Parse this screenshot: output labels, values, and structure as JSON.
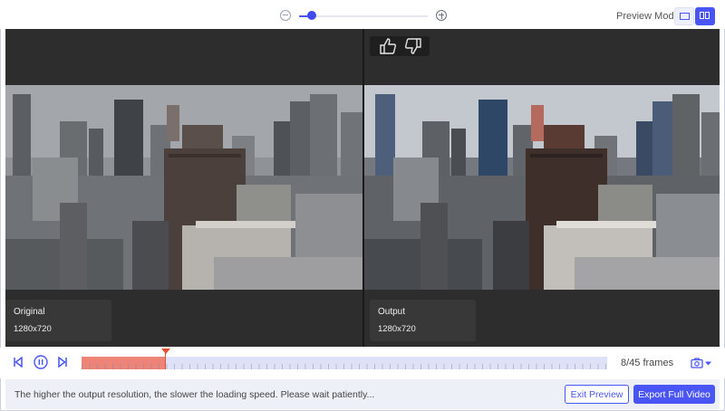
{
  "toolbar": {
    "preview_mode_label": "Preview Mode:",
    "zoom_level": 0.1,
    "icons": [
      "zoom-out-icon",
      "zoom-in-icon",
      "single-view-icon",
      "split-view-icon"
    ],
    "active_mode": "split"
  },
  "preview": {
    "feedback_icons": [
      "thumbs-up-icon",
      "thumbs-down-icon"
    ],
    "original": {
      "label": "Original",
      "resolution": "1280x720"
    },
    "output": {
      "label": "Output",
      "resolution": "1280x720"
    }
  },
  "timeline": {
    "frames_text": "8/45 frames",
    "progress": 0.16,
    "icons": [
      "skip-start-icon",
      "pause-icon",
      "skip-end-icon",
      "camera-icon",
      "dropdown-arrow-icon"
    ]
  },
  "footer": {
    "notice": "The higher the output resolution, the slower the loading speed. Please wait patiently...",
    "exit_label": "Exit Preview",
    "export_label": "Export Full Video"
  },
  "colors": {
    "accent": "#4a55f5",
    "playhead": "#e0522f",
    "played": "#ec8577"
  }
}
